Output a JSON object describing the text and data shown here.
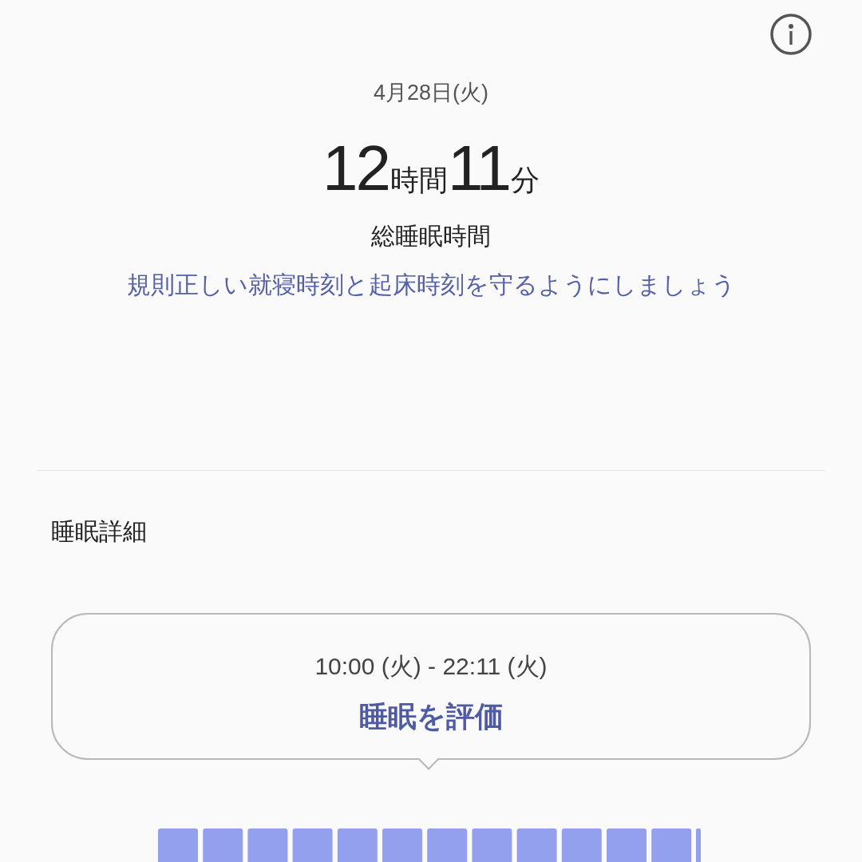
{
  "date": "4月28日(火)",
  "duration": [
    {
      "value": "12",
      "unit": "時間"
    },
    {
      "value": "11",
      "unit": "分"
    }
  ],
  "duration_label": "総睡眠時間",
  "advice": "規則正しい就寝時刻と起床時刻を守るようにしましょう",
  "details": {
    "title": "睡眠詳細",
    "time_range": "10:00 (火) - 22:11 (火)",
    "rate_link": "睡眠を評価"
  }
}
